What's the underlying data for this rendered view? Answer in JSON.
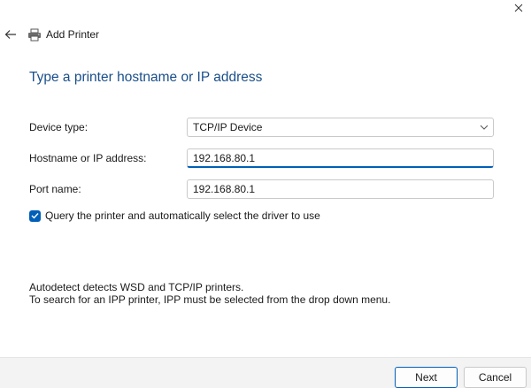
{
  "window": {
    "title": "Add Printer"
  },
  "page": {
    "title": "Type a printer hostname or IP address"
  },
  "form": {
    "device_type": {
      "label": "Device type:",
      "value": "TCP/IP Device"
    },
    "hostname": {
      "label": "Hostname or IP address:",
      "value": "192.168.80.1"
    },
    "port_name": {
      "label": "Port name:",
      "value": "192.168.80.1"
    },
    "query_checkbox": {
      "label": "Query the printer and automatically select the driver to use",
      "checked": true
    }
  },
  "info": {
    "line1": "Autodetect detects WSD and TCP/IP printers.",
    "line2": "To search for an IPP printer, IPP must be selected from the drop down menu."
  },
  "buttons": {
    "next": "Next",
    "cancel": "Cancel"
  },
  "colors": {
    "accent": "#005fb8",
    "title": "#1a4f8b",
    "footer_bg": "#f3f3f3"
  },
  "icons": {
    "close": "close-icon",
    "back": "back-arrow-icon",
    "printer": "printer-icon",
    "chevron": "chevron-down-icon",
    "check": "checkmark-icon"
  }
}
